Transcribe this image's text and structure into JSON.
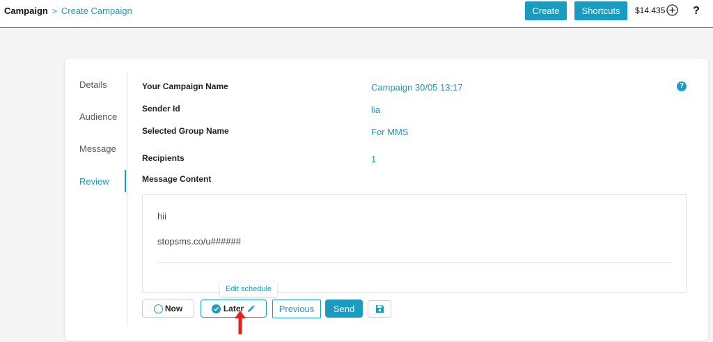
{
  "breadcrumb": {
    "root": "Campaign",
    "separator": ">",
    "current": "Create Campaign"
  },
  "header": {
    "create_label": "Create",
    "shortcuts_label": "Shortcuts",
    "balance": "$14.435",
    "help_label": "?"
  },
  "steps": [
    {
      "label": "Details"
    },
    {
      "label": "Audience"
    },
    {
      "label": "Message"
    },
    {
      "label": "Review"
    }
  ],
  "review": {
    "campaign_name_label": "Your Campaign Name",
    "campaign_name_value": "Campaign 30/05 13:17",
    "sender_id_label": "Sender Id",
    "sender_id_value": "lia",
    "group_label": "Selected Group Name",
    "group_value": "For MMS",
    "recipients_label": "Recipients",
    "recipients_value": "1",
    "message_label": "Message Content",
    "help_label": "?"
  },
  "message": {
    "line1": "hii",
    "line2": "stopsms.co/u######"
  },
  "schedule": {
    "tooltip": "Edit schedule",
    "now_label": "Now",
    "later_label": "Later",
    "selected": "Later"
  },
  "actions": {
    "previous_label": "Previous",
    "send_label": "Send"
  },
  "colors": {
    "accent": "#1a9bbf",
    "arrow": "#e8201c"
  }
}
